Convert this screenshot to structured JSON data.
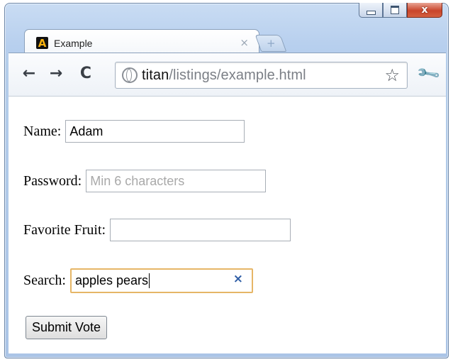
{
  "browser": {
    "tab_title": "Example",
    "tab_close": "×",
    "new_tab": "+",
    "window_close": "x",
    "url_host": "titan",
    "url_path": "/listings/example.html",
    "back": "←",
    "forward": "→",
    "reload": "C",
    "star": "☆",
    "wrench": "🔧",
    "favicon_letter": "A"
  },
  "form": {
    "name_label": "Name:",
    "name_value": "Adam",
    "password_label": "Password:",
    "password_placeholder": "Min 6 characters",
    "fruit_label": "Favorite Fruit:",
    "fruit_value": "",
    "search_label": "Search:",
    "search_value": "apples pears",
    "search_clear": "×",
    "submit_label": "Submit Vote"
  },
  "colors": {
    "search_focus_border": "#e6b667",
    "clear_icon": "#2f5ea6",
    "window_close": "#c9452b"
  }
}
